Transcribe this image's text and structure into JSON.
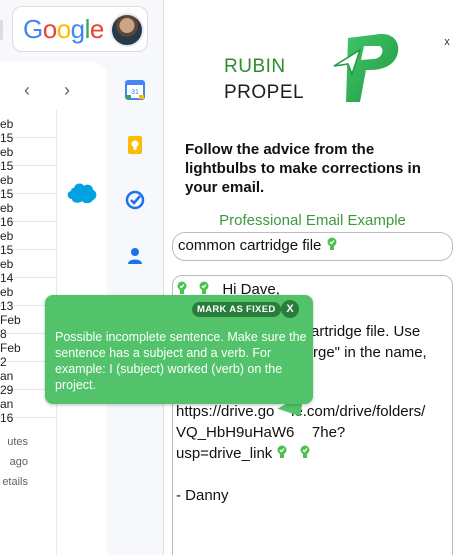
{
  "gmail": {
    "logo_text": "Google",
    "nav_prev": "‹",
    "nav_next": "›",
    "dates": [
      "eb 15",
      "eb 15",
      "eb 15",
      "eb 16",
      "eb 15",
      "eb 14",
      "eb 13",
      "Feb 8",
      "Feb 2",
      "an 29",
      "an 16"
    ],
    "footer": [
      "utes",
      "ago",
      "etails"
    ]
  },
  "panel": {
    "close": "x",
    "brand_line1": "RUBIN",
    "brand_line2": "PROPEL",
    "instructions": "Follow the advice from the lightbulbs to make corrections in your email.",
    "example_title": "Professional Email Example",
    "subject": "common cartridge file",
    "email": {
      "greeting": "Hi Dave,",
      "line2": "n cartridge file. Use",
      "line3": "rge\" in the name,",
      "url1": "https://drive.go",
      "url1_tail": "le.com/drive/folders/",
      "url2": "VQ_HbH9uHaW6",
      "url2_tail": "7he?",
      "url3": "usp=drive_link",
      "sign": "- Danny"
    },
    "colors": {
      "brand_green": "#2f8c2f",
      "tooltip_bg": "#52c36a",
      "tooltip_dark": "#277d39"
    }
  },
  "tooltip": {
    "mark_fixed_label": "MARK AS FIXED",
    "close_label": "X",
    "message": "Possible incomplete sentence. Make sure the sentence has a subject and a verb. For example: I (subject) worked (verb) on the project."
  }
}
